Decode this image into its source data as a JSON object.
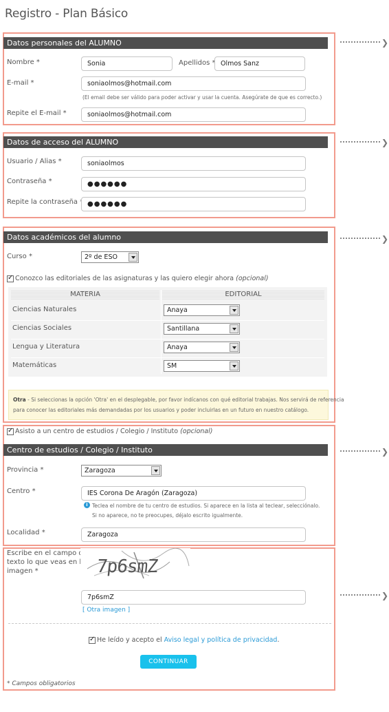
{
  "title": "Registro - Plan Básico",
  "personal": {
    "header": "Datos personales del ALUMNO",
    "nombre_label": "Nombre *",
    "nombre_value": "Sonia",
    "apellidos_label": "Apellidos *",
    "apellidos_value": "Olmos Sanz",
    "email_label": "E-mail *",
    "email_value": "soniaolmos@hotmail.com",
    "email_hint": "(El email debe ser válido para poder activar y usar la cuenta. Asegúrate de que es correcto.)",
    "email2_label": "Repite el E-mail *",
    "email2_value": "soniaolmos@hotmail.com"
  },
  "access": {
    "header": "Datos de acceso del ALUMNO",
    "usuario_label": "Usuario / Alias *",
    "usuario_value": "soniaolmos",
    "password_label": "Contraseña *",
    "password_value": "●●●●●●",
    "password2_label": "Repite la contraseña *",
    "password2_value": "●●●●●●"
  },
  "academic": {
    "header": "Datos académicos del alumno",
    "curso_label": "Curso *",
    "curso_value": "2º de ESO",
    "editoriales_check_label": "Conozco las editoriales de las asignaturas y las quiero elegir ahora",
    "editoriales_optional": "(opcional)",
    "table_headers": [
      "MATERIA",
      "EDITORIAL"
    ],
    "rows": [
      {
        "materia": "Ciencias Naturales",
        "editorial": "Anaya"
      },
      {
        "materia": "Ciencias Sociales",
        "editorial": "Santillana"
      },
      {
        "materia": "Lengua y Literatura",
        "editorial": "Anaya"
      },
      {
        "materia": "Matemáticas",
        "editorial": "SM"
      }
    ],
    "note_bold": "Otra",
    "note_line1": " - Si seleccionas la opción 'Otra' en el desplegable, por favor indícanos con qué editorial trabajas. Nos servirá de referencia",
    "note_line2": "para conocer las editoriales más demandadas por los usuarios y poder incluirlas en un futuro en nuestro catálogo."
  },
  "school": {
    "check_label": "Asisto a un centro de estudios / Colegio / Instituto",
    "check_optional": "(opcional)",
    "header": "Centro de estudios / Colegio / Instituto",
    "provincia_label": "Provincia *",
    "provincia_value": "Zaragoza",
    "centro_label": "Centro *",
    "centro_value": "IES Corona De Aragón (Zaragoza)",
    "centro_hint1": "Teclea el nombre de tu centro de estudios. Si aparece en la lista al teclear, selecciónalo.",
    "centro_hint2": "Si no aparece, no te preocupes, déjalo escrito igualmente.",
    "localidad_label": "Localidad *",
    "localidad_value": "Zaragoza"
  },
  "captcha": {
    "prompt_line1": "Escribe en el campo de",
    "prompt_line2": "texto lo que veas en la",
    "prompt_line3": "imagen *",
    "image_text": "7p6smZ",
    "value": "7p6smZ",
    "other_image": "[ Otra imagen ]",
    "accept_prefix": "He leído y acepto el ",
    "accept_link": "Aviso legal y política de privacidad",
    "accept_suffix": ".",
    "submit": "CONTINUAR",
    "required_note": "* Campos obligatorios"
  },
  "icons": {
    "arrow": "chevron-right-icon",
    "check": "checkbox-checked-icon",
    "info": "info-icon"
  },
  "colors": {
    "section_border": "#f29a8c",
    "header_bar": "#4f4f4f",
    "button": "#19c1ec",
    "link": "#2a9ad6",
    "note_bg": "#fdf8dc"
  }
}
